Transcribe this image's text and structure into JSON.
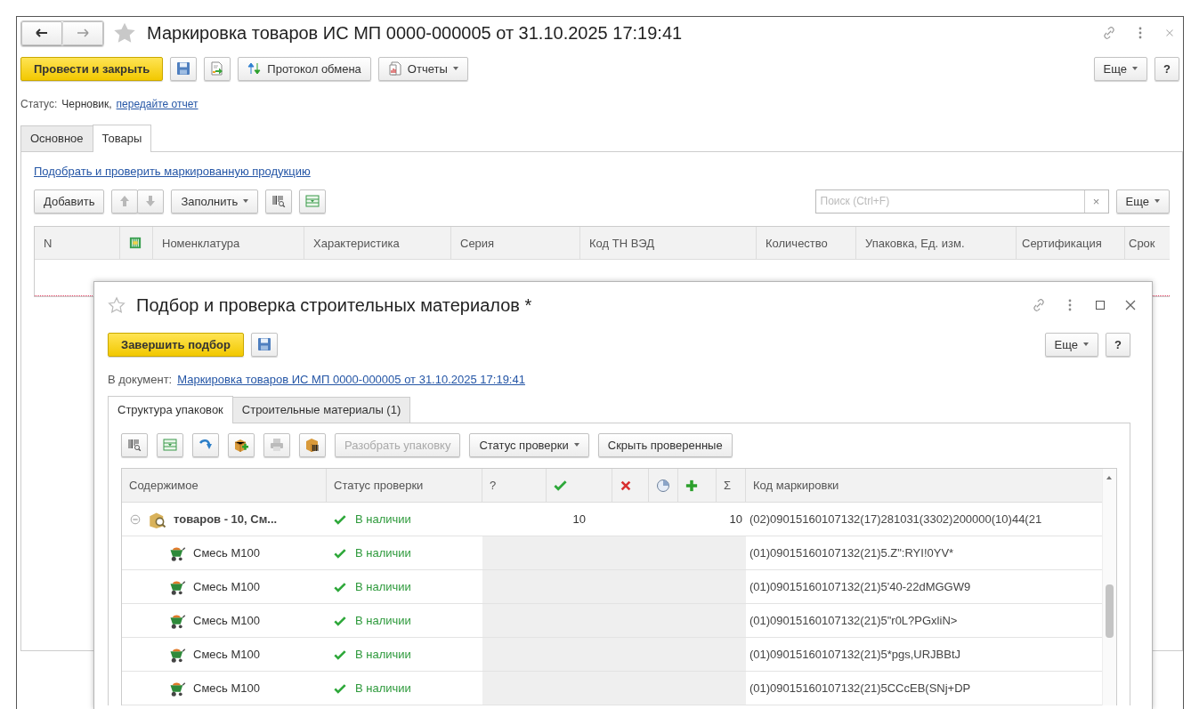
{
  "window": {
    "title": "Маркировка товаров ИС МП 0000-000005 от 31.10.2025 17:19:41"
  },
  "toolbar": {
    "primary": "Провести и закрыть",
    "exchange": "Протокол обмена",
    "reports": "Отчеты",
    "more": "Еще",
    "help": "?"
  },
  "status": {
    "label": "Статус:",
    "value": "Черновик,",
    "link": "передайте отчет"
  },
  "tabs": [
    {
      "label": "Основное",
      "selected": false
    },
    {
      "label": "Товары",
      "selected": true
    }
  ],
  "goods": {
    "link": "Подобрать и проверить маркированную продукцию",
    "add": "Добавить",
    "fill": "Заполнить",
    "search": {
      "placeholder": "Поиск (Ctrl+F)",
      "clear": "×"
    },
    "more": "Еще",
    "columns": [
      {
        "kind": "text",
        "label": "N"
      },
      {
        "kind": "icon"
      },
      {
        "kind": "text",
        "label": "Номенклатура"
      },
      {
        "kind": "text",
        "label": "Характеристика"
      },
      {
        "kind": "text",
        "label": "Серия"
      },
      {
        "kind": "text",
        "label": "Код ТН ВЭД"
      },
      {
        "kind": "text",
        "label": "Количество"
      },
      {
        "kind": "text",
        "label": "Упаковка, Ед. изм."
      },
      {
        "kind": "text",
        "label": "Сертификация"
      },
      {
        "kind": "text",
        "label": "Срок"
      }
    ]
  },
  "dialog": {
    "title": "Подбор и проверка строительных материалов *",
    "primary": "Завершить подбор",
    "more": "Еще",
    "help": "?",
    "document": {
      "label": "В документ:",
      "link": "Маркировка товаров ИС МП 0000-000005 от 31.10.2025 17:19:41"
    },
    "tabs": [
      {
        "label": "Структура упаковок",
        "selected": true
      },
      {
        "label": "Строительные материалы (1)",
        "selected": false
      }
    ],
    "toolbar": [
      {
        "label": "Разобрать упаковку",
        "disabled": true,
        "dropdown": false
      },
      {
        "label": "Статус проверки",
        "disabled": false,
        "dropdown": true
      },
      {
        "label": "Скрыть проверенные",
        "disabled": false,
        "dropdown": false
      }
    ],
    "grid": {
      "columns": [
        {
          "kind": "text",
          "label": "Содержимое"
        },
        {
          "kind": "text",
          "label": "Статус проверки"
        },
        {
          "kind": "text",
          "label": "?"
        },
        {
          "kind": "check"
        },
        {
          "kind": "cross"
        },
        {
          "kind": "pie"
        },
        {
          "kind": "plus"
        },
        {
          "kind": "text",
          "label": "Σ"
        },
        {
          "kind": "text",
          "label": "Код маркировки"
        }
      ],
      "rows": [
        {
          "kind": "package",
          "content": "товаров - 10, См...",
          "expanded": true,
          "status": "В наличии",
          "found": "10",
          "total": "10",
          "code": "(02)09015160107132(17)281031(3302)200000(10)44(21",
          "children": [
            {
              "kind": "item",
              "content": "Смесь М100",
              "status": "В наличии",
              "code": "(01)09015160107132(21)5.Z\":RYI!0YV*"
            },
            {
              "kind": "item",
              "content": "Смесь М100",
              "status": "В наличии",
              "code": "(01)09015160107132(21)5'40-22dMGGW9"
            },
            {
              "kind": "item",
              "content": "Смесь М100",
              "status": "В наличии",
              "code": "(01)09015160107132(21)5\"r0L?PGxliN>"
            },
            {
              "kind": "item",
              "content": "Смесь М100",
              "status": "В наличии",
              "code": "(01)09015160107132(21)5*pgs,URJBBtJ"
            },
            {
              "kind": "item",
              "content": "Смесь М100",
              "status": "В наличии",
              "code": "(01)09015160107132(21)5CCcEB(SNj+DP"
            }
          ]
        }
      ]
    }
  }
}
